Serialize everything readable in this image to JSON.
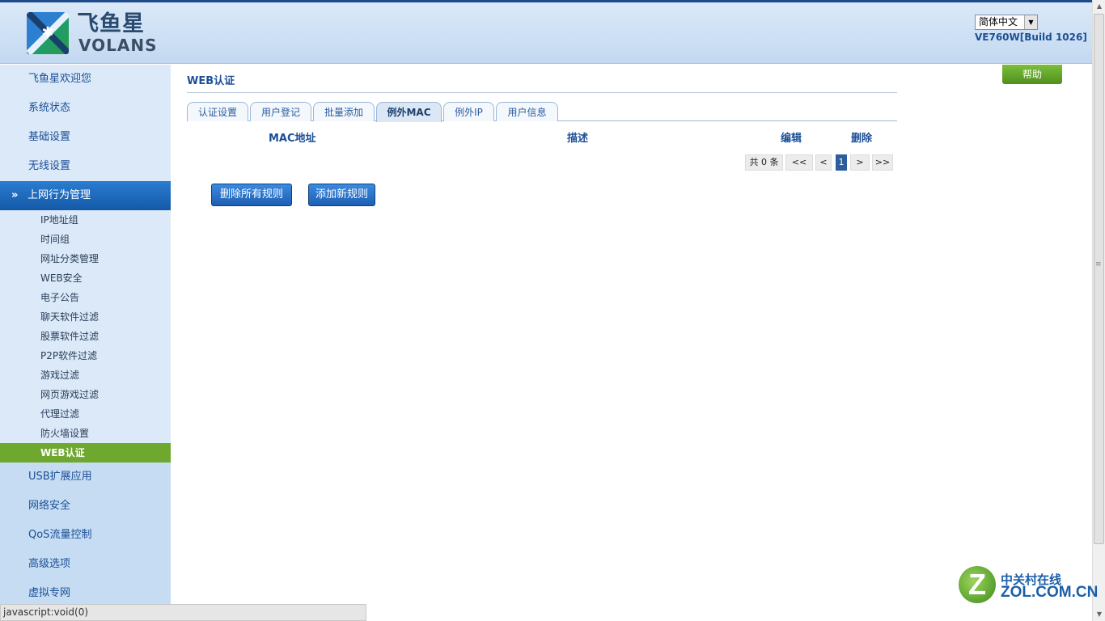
{
  "header": {
    "logo_cn": "飞鱼星",
    "logo_en": "VOLANS",
    "language": "简体中文",
    "build": "VE760W[Build 1026]"
  },
  "sidebar": {
    "top_items": [
      "飞鱼星欢迎您",
      "系统状态",
      "基础设置",
      "无线设置"
    ],
    "active_item": "上网行为管理",
    "sub_items": [
      "IP地址组",
      "时间组",
      "网址分类管理",
      "WEB安全",
      "电子公告",
      "聊天软件过滤",
      "股票软件过滤",
      "P2P软件过滤",
      "游戏过滤",
      "网页游戏过滤",
      "代理过滤",
      "防火墙设置"
    ],
    "selected_sub_item": "WEB认证",
    "bottom_items": [
      "USB扩展应用",
      "网络安全",
      "QoS流量控制",
      "高级选项",
      "虚拟专网"
    ]
  },
  "main": {
    "title": "WEB认证",
    "help_label": "帮助",
    "tabs": [
      "认证设置",
      "用户登记",
      "批量添加",
      "例外MAC",
      "例外IP",
      "用户信息"
    ],
    "active_tab": "例外MAC",
    "columns": [
      "MAC地址",
      "描述",
      "编辑",
      "删除"
    ],
    "pager": {
      "total": "共 0 条",
      "first": "<<",
      "prev": "<",
      "current": "1",
      "next": ">",
      "last": ">>"
    },
    "buttons": {
      "delete_all": "删除所有规则",
      "add_new": "添加新规则"
    }
  },
  "statusbar": "javascript:void(0)",
  "watermark": {
    "cn": "中关村在线",
    "en": "ZOL.COM.CN",
    "glyph": "Z"
  },
  "colors": {
    "brand_blue": "#1c4f96",
    "active_nav": "#1458a8",
    "selected_green": "#6ea82e"
  }
}
